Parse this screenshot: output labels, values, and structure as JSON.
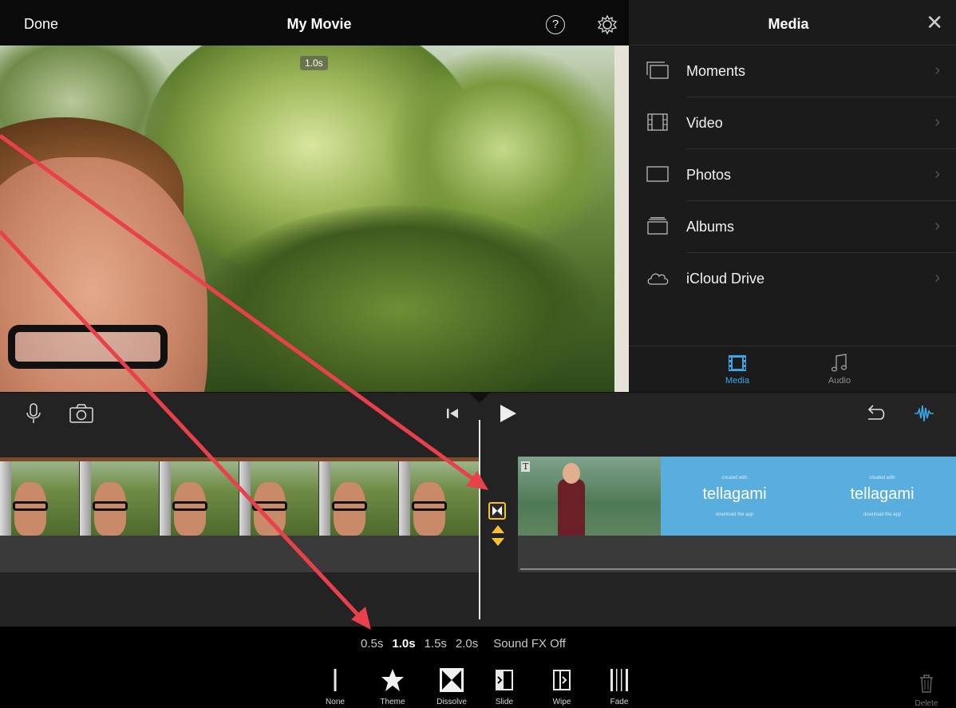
{
  "topbar": {
    "done_label": "Done",
    "title": "My Movie",
    "help_glyph": "?"
  },
  "viewer": {
    "timecode": "1.0s"
  },
  "media_panel": {
    "title": "Media",
    "close_glyph": "✕",
    "items": [
      {
        "label": "Moments",
        "icon": "moments-icon"
      },
      {
        "label": "Video",
        "icon": "film-icon"
      },
      {
        "label": "Photos",
        "icon": "photo-icon"
      },
      {
        "label": "Albums",
        "icon": "albums-icon"
      },
      {
        "label": "iCloud Drive",
        "icon": "cloud-icon"
      }
    ],
    "chevron": "›",
    "tabs": [
      {
        "label": "Media",
        "active": true,
        "color": "#3aa6e8"
      },
      {
        "label": "Audio",
        "active": false,
        "color": "#8e8e8e"
      }
    ]
  },
  "timeline": {
    "clip2_title_badge": "T",
    "tellagami": [
      {
        "small": "created with",
        "brand": "tellagami",
        "sub": "download the app"
      },
      {
        "small": "created with",
        "brand": "tellagami",
        "sub": "download the app"
      }
    ]
  },
  "transitions": {
    "durations": [
      "0.5s",
      "1.0s",
      "1.5s",
      "2.0s"
    ],
    "selected_duration": "1.0s",
    "sound_fx": "Sound FX Off",
    "types": [
      {
        "label": "None",
        "icon": "none-icon"
      },
      {
        "label": "Theme",
        "icon": "star-icon"
      },
      {
        "label": "Dissolve",
        "icon": "dissolve-icon"
      },
      {
        "label": "Slide",
        "icon": "slide-icon"
      },
      {
        "label": "Wipe",
        "icon": "wipe-icon"
      },
      {
        "label": "Fade",
        "icon": "fade-icon"
      }
    ],
    "delete_label": "Delete"
  },
  "colors": {
    "accent_blue": "#3aa6e8",
    "transition_yellow": "#f2c230",
    "annotation_red": "#e8414b"
  }
}
